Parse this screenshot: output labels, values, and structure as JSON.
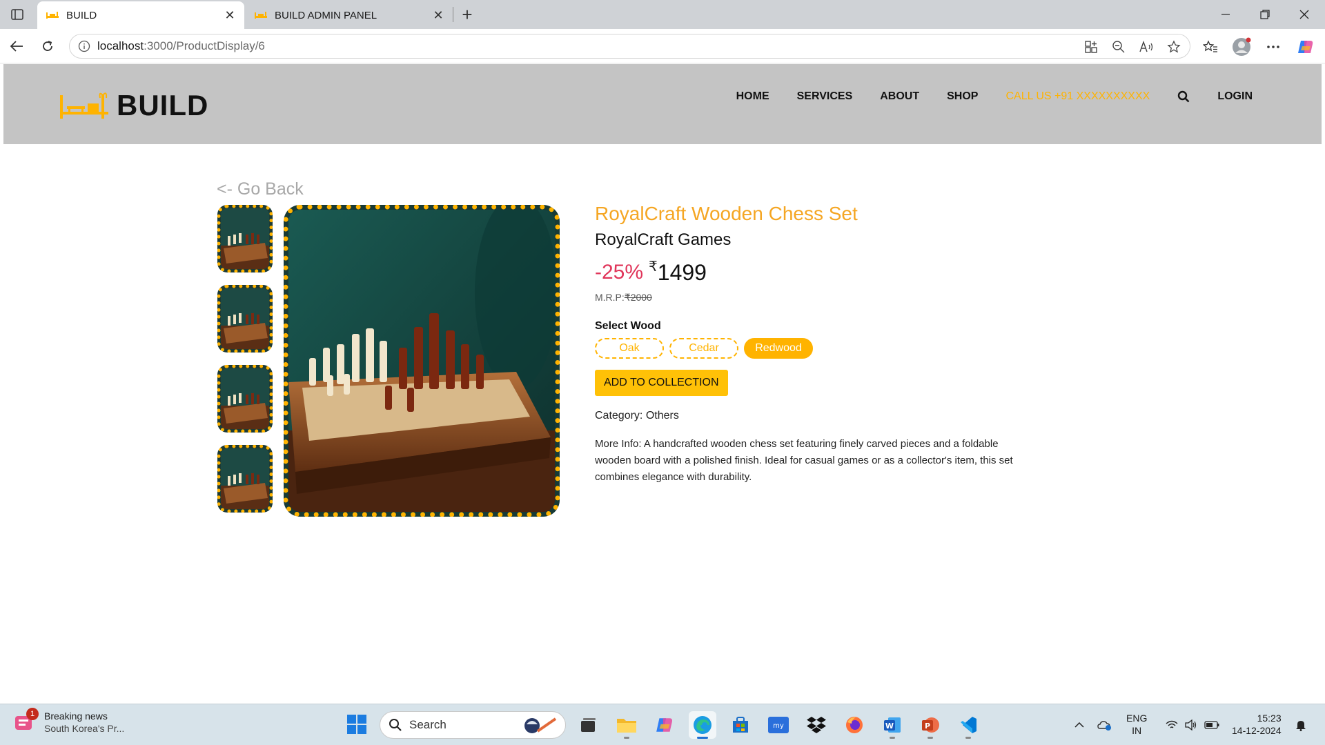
{
  "browser": {
    "tabs": [
      {
        "title": "BUILD",
        "active": true
      },
      {
        "title": "BUILD ADMIN PANEL",
        "active": false
      }
    ],
    "url_host": "localhost",
    "url_rest": ":3000/ProductDisplay/6"
  },
  "site": {
    "brand": "BUILD",
    "nav": {
      "home": "HOME",
      "services": "SERVICES",
      "about": "ABOUT",
      "shop": "SHOP",
      "call": "CALL US +91 XXXXXXXXXX",
      "login": "LOGIN"
    },
    "accent_color": "#ffb300"
  },
  "product": {
    "go_back": "<- Go Back",
    "title": "RoyalCraft Wooden Chess Set",
    "brand": "RoyalCraft Games",
    "discount": "-25%",
    "currency": "₹",
    "price": "1499",
    "mrp_label": "M.R.P:",
    "mrp_value": "₹2000",
    "select_label": "Select Wood",
    "wood_options": [
      "Oak",
      "Cedar",
      "Redwood"
    ],
    "selected_wood": "Redwood",
    "add_button": "ADD TO COLLECTION",
    "category": "Category: Others",
    "more_info": "More Info: A handcrafted wooden chess set featuring finely carved pieces and a foldable wooden board with a polished finish. Ideal for casual games or as a collector's item, this set combines elegance with durability."
  },
  "taskbar": {
    "news_badge": "1",
    "news_title": "Breaking news",
    "news_sub": "South Korea's Pr...",
    "search_label": "Search",
    "lang_1": "ENG",
    "lang_2": "IN",
    "time": "15:23",
    "date": "14-12-2024"
  }
}
